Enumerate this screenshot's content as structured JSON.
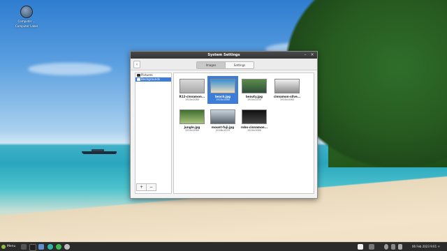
{
  "desktop": {
    "icon_label_line1": "Computer ...",
    "icon_label_line2": "Computer Label"
  },
  "window": {
    "title": "System Settings",
    "back_glyph": "‹",
    "min_glyph": "–",
    "close_glyph": "×",
    "tabs": [
      {
        "label": "Images",
        "active": true
      },
      {
        "label": "Settings",
        "active": false
      }
    ],
    "sidebar": {
      "items": [
        {
          "label": "Pictures",
          "selected": false
        },
        {
          "label": "Backgrounds",
          "selected": true
        }
      ],
      "add_label": "+",
      "remove_label": "−"
    },
    "images": [
      {
        "name": "R12-cinnamon...",
        "size": "1920x1080",
        "selected": false,
        "colors": [
          "#d8d8d8",
          "#a9a9a9"
        ]
      },
      {
        "name": "beach.jpg",
        "size": "1920x1080",
        "selected": true,
        "colors": [
          "#3a8fd0",
          "#e9dcc0"
        ]
      },
      {
        "name": "beauty.jpg",
        "size": "1920x1200",
        "selected": false,
        "colors": [
          "#5b8d4a",
          "#2f4e3a"
        ]
      },
      {
        "name": "cinnamon-silve...",
        "size": "1920x1080",
        "selected": false,
        "colors": [
          "#f0f0f0",
          "#8c8c8c"
        ]
      },
      {
        "name": "jungle.jpg",
        "size": "1920x1080",
        "selected": false,
        "colors": [
          "#3f6e2f",
          "#a6c27a"
        ]
      },
      {
        "name": "mount-fuji.jpg",
        "size": "2048x1229",
        "selected": false,
        "colors": [
          "#c9d3dc",
          "#5b6470"
        ]
      },
      {
        "name": "robo-cinnamon...",
        "size": "1920x1080",
        "selected": false,
        "colors": [
          "#111111",
          "#444444"
        ]
      }
    ]
  },
  "taskbar": {
    "menu_label": "Menu",
    "clock": "06 Feb 2023  9:01 ☼"
  },
  "colors": {
    "accent": "#3b7dd8",
    "titlebar": "#3c3c3c",
    "taskbar": "#2b2b2b"
  }
}
